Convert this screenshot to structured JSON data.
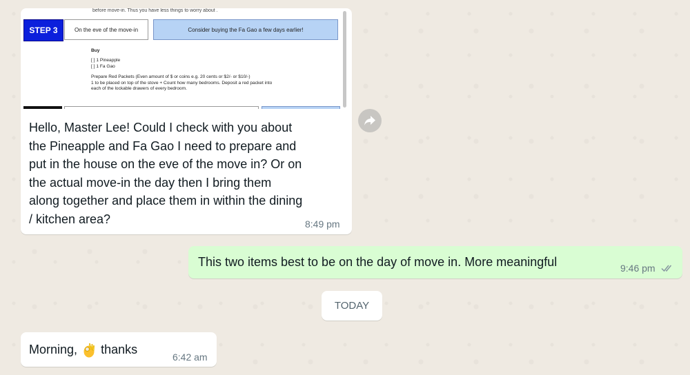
{
  "messages": [
    {
      "direction": "incoming",
      "document_preview": {
        "top_text": "before move-in. Thus you have less things to worry about .",
        "step_badge": "STEP 3",
        "step_desc": "On the eve of the move-in",
        "step_note": "Consider buying the Fa Gao a few days earlier!",
        "buy_heading": "Buy",
        "items": [
          "[   ] 1 Pineapple",
          "[   ] 1 Fa Gao"
        ],
        "packets_line1": "Prepare Red Packets (Even amount of $ or coins e.g. 20 cents or $2/- or $10/-)",
        "packets_line2": "1 to be placed on top of the stove + Count how many bedrooms. Deposit a red packet into",
        "packets_line3": "each of the lockable drawers of every bedroom."
      },
      "text_lines": [
        "Hello, Master Lee! Could I check with you about",
        "the Pineapple and Fa Gao I need to prepare and",
        "put in the house on the eve of the move in? Or on",
        "the actual move-in the day then I bring them",
        "along together and place them in within the dining",
        "/ kitchen area?"
      ],
      "time": "8:49 pm"
    },
    {
      "direction": "outgoing",
      "text": "This two items best to be on the day of move in. More meaningful",
      "time": "9:46 pm",
      "status_icon": "double-check-icon"
    },
    {
      "direction": "incoming",
      "text_before_emoji": "Morning,",
      "emoji": "ok-hand-emoji",
      "text_after_emoji": "thanks",
      "time": "6:42 am"
    }
  ],
  "date_separator": "TODAY",
  "forward_icon": "forward-share-icon"
}
